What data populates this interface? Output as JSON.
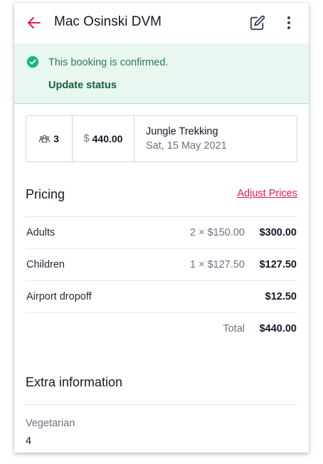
{
  "header": {
    "title": "Mac Osinski DVM",
    "back_icon": "arrow-left-icon",
    "edit_icon": "edit-icon",
    "menu_icon": "more-vertical-icon"
  },
  "banner": {
    "message": "This booking is confirmed.",
    "action": "Update status",
    "icon": "check-circle-icon"
  },
  "summary": {
    "guests": "3",
    "currency": "$",
    "price": "440.00",
    "tour_name": "Jungle Trekking",
    "tour_date": "Sat, 15 May 2021"
  },
  "pricing": {
    "title": "Pricing",
    "adjust_link": "Adjust Prices",
    "rows": [
      {
        "label": "Adults",
        "qty": "2 × $150.00",
        "amount": "$300.00"
      },
      {
        "label": "Children",
        "qty": "1 × $127.50",
        "amount": "$127.50"
      },
      {
        "label": "Airport dropoff",
        "qty": "",
        "amount": "$12.50"
      }
    ],
    "total_label": "Total",
    "total_amount": "$440.00"
  },
  "extra": {
    "title": "Extra information",
    "fields": [
      {
        "label": "Vegetarian",
        "value": "4"
      }
    ]
  },
  "colors": {
    "accent": "#e11d48",
    "success_bg": "#e8f8f0",
    "success_text": "#17603f"
  }
}
